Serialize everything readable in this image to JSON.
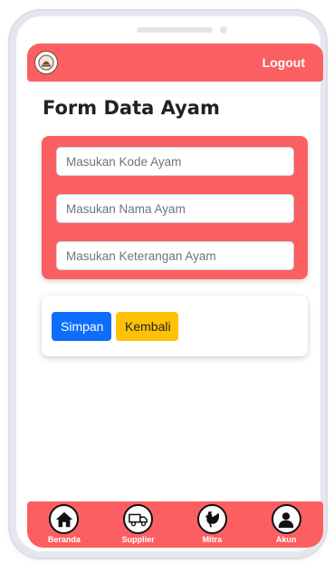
{
  "header": {
    "logout_label": "Logout"
  },
  "page": {
    "title": "Form Data Ayam"
  },
  "form": {
    "kode_placeholder": "Masukan Kode Ayam",
    "nama_placeholder": "Masukan Nama Ayam",
    "keterangan_placeholder": "Masukan Keterangan Ayam"
  },
  "actions": {
    "save_label": "Simpan",
    "back_label": "Kembali"
  },
  "nav": {
    "items": [
      {
        "label": "Beranda",
        "icon": "home-icon"
      },
      {
        "label": "Supplier",
        "icon": "truck-icon"
      },
      {
        "label": "Mitra",
        "icon": "rooster-icon"
      },
      {
        "label": "Akun",
        "icon": "user-icon"
      }
    ]
  },
  "colors": {
    "accent": "#fb5f61",
    "primary": "#0d6efd",
    "warning": "#ffc107"
  }
}
